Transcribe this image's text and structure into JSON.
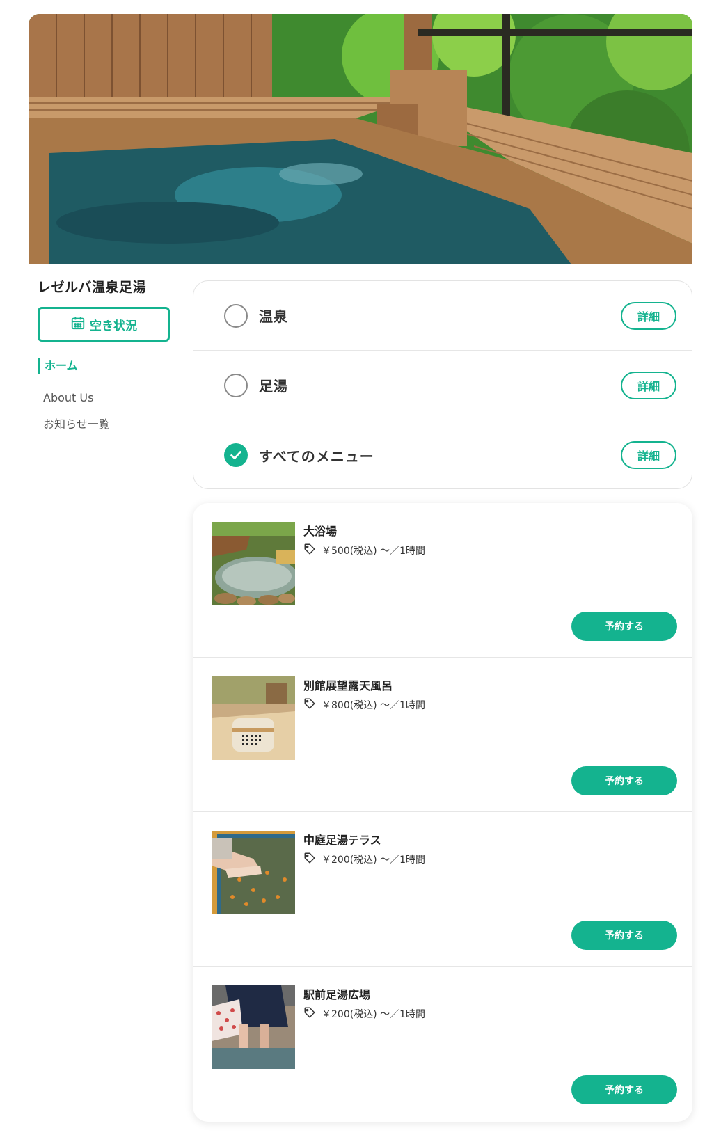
{
  "site": {
    "title": "レゼルバ温泉足湯",
    "availability_label": "空き状況"
  },
  "nav": {
    "items": [
      {
        "label": "ホーム",
        "active": true
      },
      {
        "label": "About Us",
        "active": false
      },
      {
        "label": "お知らせ一覧",
        "active": false
      }
    ]
  },
  "categories": [
    {
      "label": "温泉",
      "selected": false,
      "detail_label": "詳細"
    },
    {
      "label": "足湯",
      "selected": false,
      "detail_label": "詳細"
    },
    {
      "label": "すべてのメニュー",
      "selected": true,
      "detail_label": "詳細"
    }
  ],
  "menu": [
    {
      "name": "大浴場",
      "price": "￥500(税込) 〜／1時間",
      "reserve_label": "予約する",
      "icon": "tag-icon"
    },
    {
      "name": "別館展望露天風呂",
      "price": "￥800(税込) 〜／1時間",
      "reserve_label": "予約する",
      "icon": "tag-icon"
    },
    {
      "name": "中庭足湯テラス",
      "price": "￥200(税込) 〜／1時間",
      "reserve_label": "予約する",
      "icon": "tag-icon"
    },
    {
      "name": "駅前足湯広場",
      "price": "￥200(税込) 〜／1時間",
      "reserve_label": "予約する",
      "icon": "tag-icon"
    }
  ],
  "colors": {
    "accent": "#14b38f"
  }
}
